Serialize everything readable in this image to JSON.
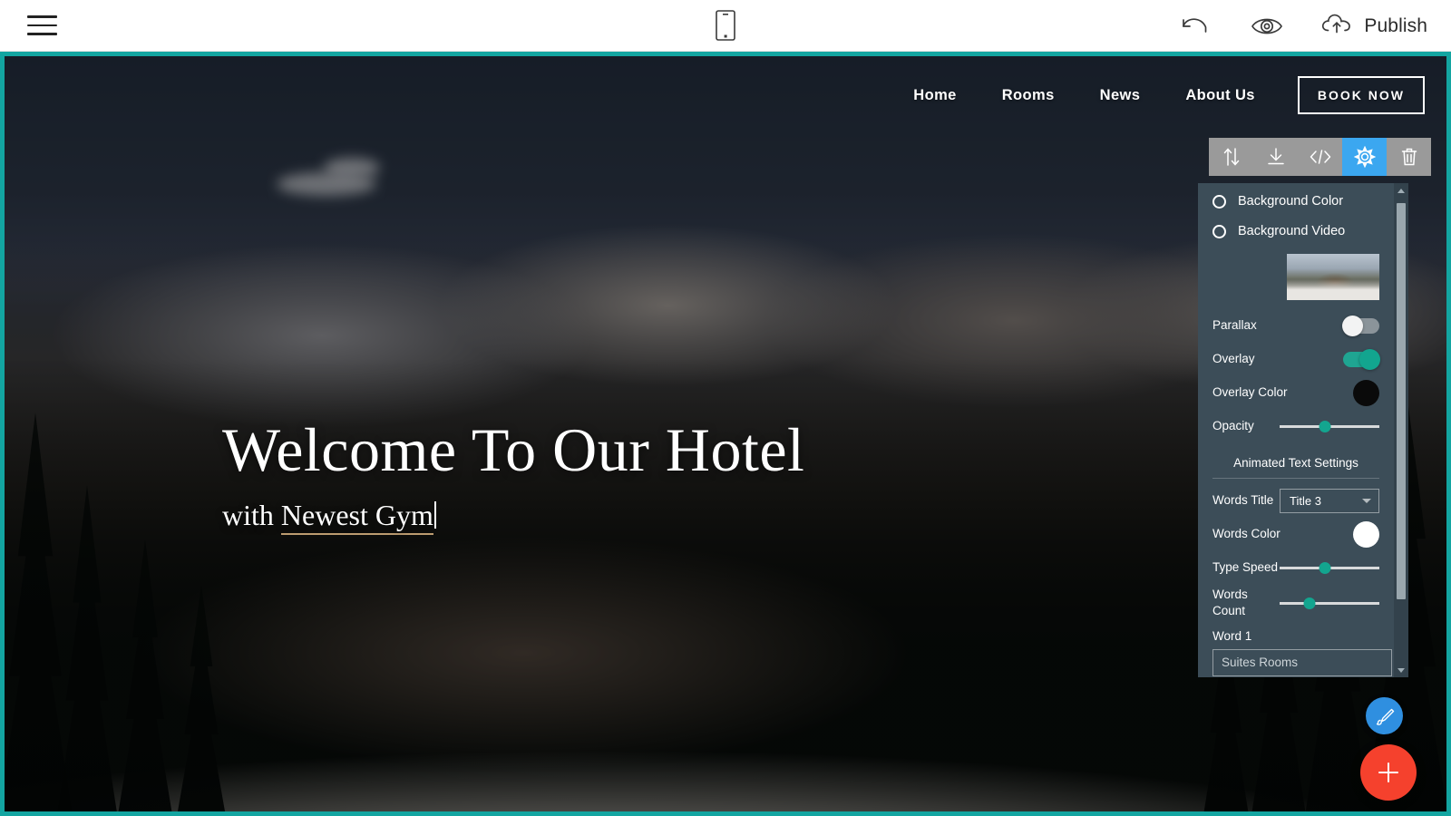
{
  "editor": {
    "menu_icon": "hamburger-menu-icon",
    "device_icon": "mobile-preview-icon",
    "undo_icon": "undo-icon",
    "preview_icon": "eye-preview-icon",
    "publish_icon": "cloud-upload-icon",
    "publish_label": "Publish"
  },
  "block_toolbar": {
    "items": [
      {
        "name": "move-block",
        "icon": "up-down-arrows-icon",
        "active": false
      },
      {
        "name": "save-block",
        "icon": "download-icon",
        "active": false
      },
      {
        "name": "edit-code",
        "icon": "code-brackets-icon",
        "active": false
      },
      {
        "name": "block-settings",
        "icon": "gear-icon",
        "active": true
      },
      {
        "name": "delete-block",
        "icon": "trash-icon",
        "active": false
      }
    ],
    "active_color": "#3ba7f0",
    "bar_color": "#9a9a9a"
  },
  "site": {
    "nav": [
      {
        "label": "Home"
      },
      {
        "label": "Rooms"
      },
      {
        "label": "News"
      },
      {
        "label": "About Us"
      }
    ],
    "cta_label": "BOOK NOW",
    "hero_title": "Welcome To Our Hotel",
    "hero_sub_prefix": "with ",
    "hero_sub_typed": "Newest Gym",
    "canvas_border_color": "#13a5a1"
  },
  "settings": {
    "options": [
      {
        "label": "Background Color",
        "selected": false
      },
      {
        "label": "Background Video",
        "selected": false
      }
    ],
    "thumbnail_name": "background-image-thumbnail",
    "rows": [
      {
        "label": "Parallax",
        "type": "toggle",
        "value": "off"
      },
      {
        "label": "Overlay",
        "type": "toggle",
        "value": "on"
      },
      {
        "label": "Overlay Color",
        "type": "color",
        "value": "#0a0a0a"
      },
      {
        "label": "Opacity",
        "type": "slider",
        "value": 45
      }
    ],
    "section_title": "Animated Text Settings",
    "words_title_label": "Words Title",
    "words_title_value": "Title 3",
    "words_color_label": "Words Color",
    "words_color_value": "#ffffff",
    "type_speed_label": "Type Speed",
    "type_speed_value": 45,
    "words_count_label": "Words Count",
    "words_count_value": 30,
    "word1_label": "Word 1",
    "word1_value": "Suites Rooms",
    "panel_color": "#3c4d58",
    "accent_color": "#13a58f"
  },
  "fabs": {
    "pen_icon": "pen-brush-icon",
    "add_icon": "plus-icon",
    "pen_color": "#2f8fe0",
    "add_color": "#f5412d"
  }
}
